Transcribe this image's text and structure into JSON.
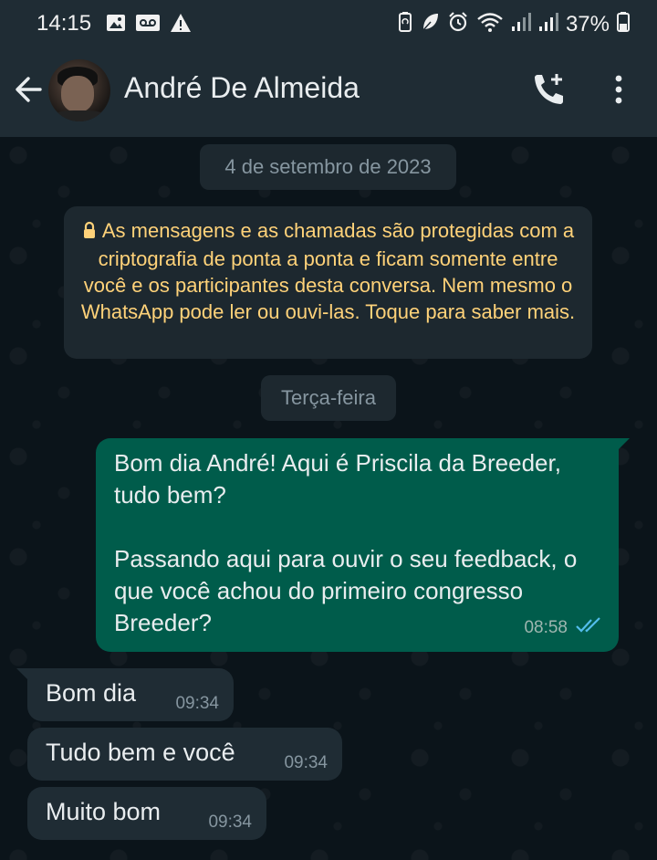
{
  "status_bar": {
    "time": "14:15",
    "battery": "37%",
    "left_icons": [
      "image-icon",
      "voicemail-icon",
      "alert-icon"
    ],
    "right_icons": [
      "battery-saver-icon",
      "leaf-icon",
      "alarm-icon",
      "wifi-icon",
      "signal-icon",
      "signal-icon",
      "battery-icon"
    ]
  },
  "header": {
    "contact_name": "André De Almeida"
  },
  "chat": {
    "date_label": "4 de setembro de 2023",
    "encryption_notice": "As mensagens e as chamadas são protegidas com a criptografia de ponta a ponta e ficam somente entre você e os participantes desta conversa. Nem mesmo o WhatsApp pode ler ou ouvi-las. Toque para saber mais.",
    "day_label": "Terça-feira",
    "messages": [
      {
        "direction": "out",
        "text": "Bom dia André! Aqui é Priscila da Breeder, tudo bem?\n\nPassando aqui para ouvir o seu feedback, o que você achou do primeiro congresso Breeder?",
        "time": "08:58",
        "status": "read"
      },
      {
        "direction": "in",
        "text": "Bom dia",
        "time": "09:34"
      },
      {
        "direction": "in",
        "text": "Tudo bem e você",
        "time": "09:34"
      },
      {
        "direction": "in",
        "text": "Muito bom",
        "time": "09:34"
      }
    ]
  },
  "colors": {
    "header_bg": "#1f2c34",
    "chat_bg": "#0b141a",
    "outgoing_bubble": "#005c4b",
    "incoming_bubble": "#1f2c34",
    "notice_text": "#ffd279",
    "read_ticks": "#53bdeb"
  }
}
